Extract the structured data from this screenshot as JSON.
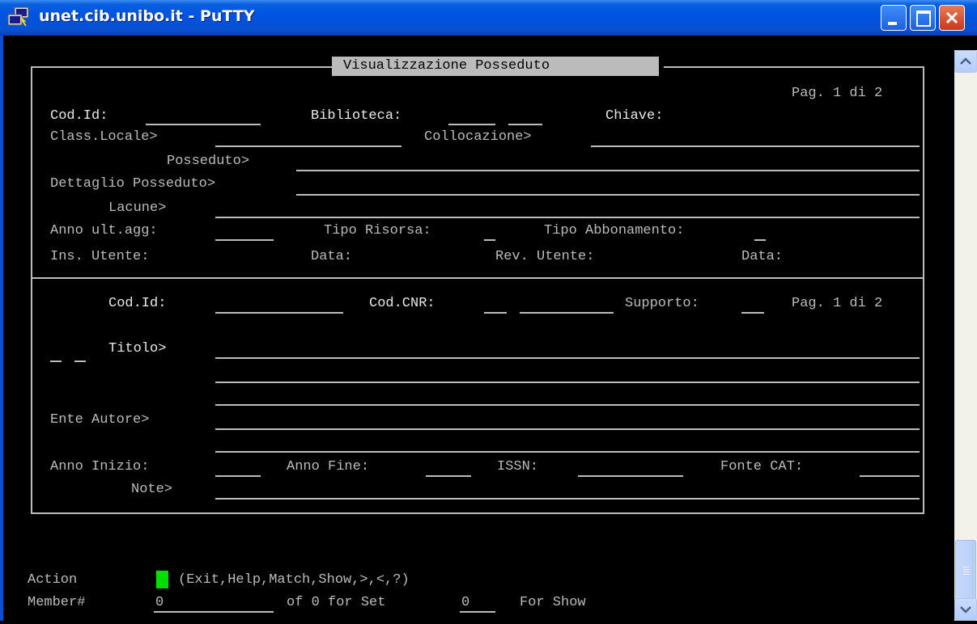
{
  "window": {
    "title": "unet.cib.unibo.it - PuTTY",
    "accent": "#0054e3"
  },
  "screen": {
    "box_title": "Visualizzazione Posseduto",
    "top": {
      "page": "Pag. 1 di 2",
      "cod_id": "Cod.Id:",
      "biblioteca": "Biblioteca:",
      "chiave": "Chiave:",
      "class_locale": "Class.Locale>",
      "collocazione": "Collocazione>",
      "posseduto": "Posseduto>",
      "dettaglio_posseduto": "Dettaglio Posseduto>",
      "lacune": "Lacune>",
      "anno_ult_agg": "Anno ult.agg:",
      "tipo_risorsa": "Tipo Risorsa:",
      "tipo_abbonamento": "Tipo Abbonamento:",
      "ins_utente": "Ins. Utente:",
      "data_1": "Data:",
      "rev_utente": "Rev. Utente:",
      "data_2": "Data:"
    },
    "bottom": {
      "cod_id": "Cod.Id:",
      "cod_cnr": "Cod.CNR:",
      "supporto": "Supporto:",
      "page": "Pag. 1 di 2",
      "titolo": "Titolo>",
      "ente_autore": "Ente Autore>",
      "anno_inizio": "Anno Inizio:",
      "anno_fine": "Anno Fine:",
      "issn": "ISSN:",
      "fonte_cat": "Fonte CAT:",
      "note": "Note>"
    },
    "command": {
      "action_label": "Action",
      "action_options": "(Exit,Help,Match,Show,>,<,?)",
      "member_label": "Member#",
      "member_value": "0",
      "of_text": "of 0 for Set",
      "set_value": "0",
      "for_show": "For Show"
    }
  },
  "icons": {
    "app": "putty-icon",
    "minimize": "minimize-icon",
    "maximize": "maximize-icon",
    "close": "close-icon",
    "scroll_up": "chevron-up-icon",
    "scroll_down": "chevron-down-icon"
  },
  "colors": {
    "cursor": "#00e000",
    "terminal_bg": "#000000",
    "terminal_fg": "#bbbbbb"
  }
}
